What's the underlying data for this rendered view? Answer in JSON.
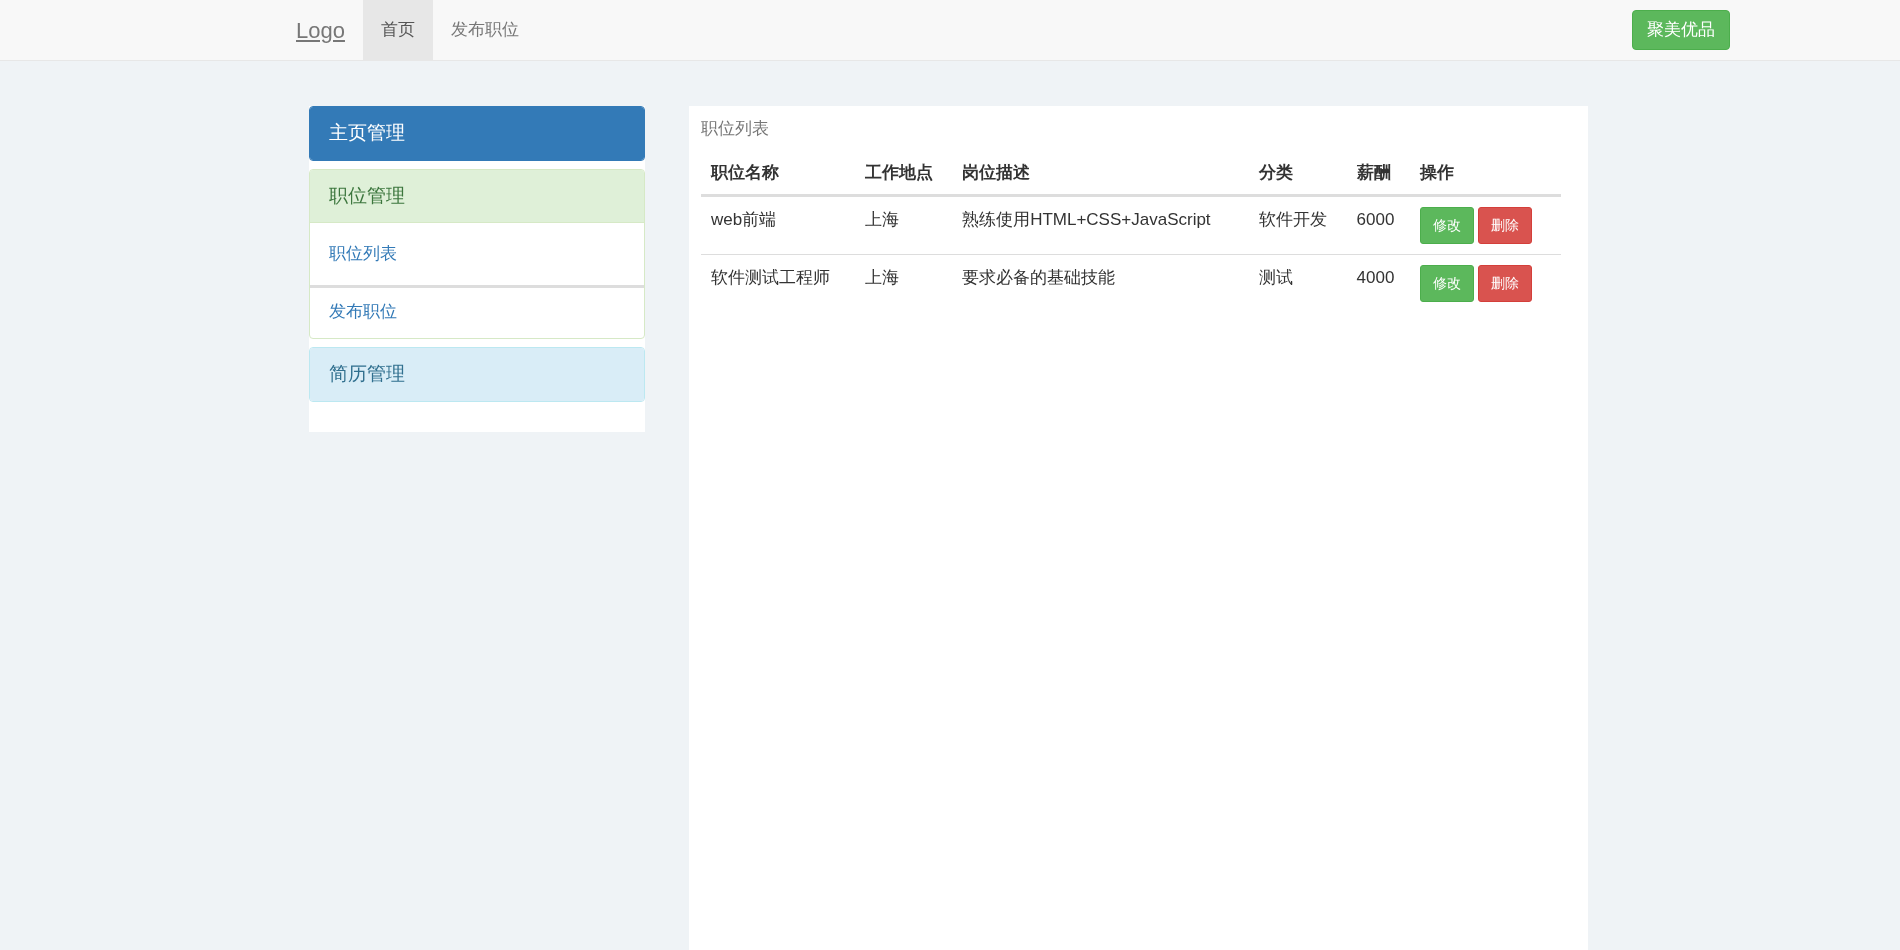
{
  "navbar": {
    "brand": "Logo",
    "tabs": [
      {
        "label": "首页",
        "selected": true
      },
      {
        "label": "发布职位",
        "selected": false
      }
    ],
    "button": "聚美优品"
  },
  "sidebar": {
    "panels": [
      {
        "kind": "primary",
        "title": "主页管理"
      },
      {
        "kind": "success",
        "title": "职位管理",
        "items": [
          "职位列表",
          "发布职位"
        ]
      },
      {
        "kind": "info",
        "title": "简历管理"
      }
    ]
  },
  "main": {
    "title": "职位列表",
    "table": {
      "columns": [
        "职位名称",
        "工作地点",
        "岗位描述",
        "分类",
        "薪酬",
        "操作"
      ],
      "rows": [
        {
          "cells": [
            "web前端",
            "上海",
            "熟练使用HTML+CSS+JavaScript",
            "软件开发",
            "6000"
          ],
          "actions": [
            {
              "kind": "edit",
              "label": "修改"
            },
            {
              "kind": "delete",
              "label": "删除"
            }
          ]
        },
        {
          "cells": [
            "软件测试工程师",
            "上海",
            "要求必备的基础技能",
            "测试",
            "4000"
          ],
          "actions": [
            {
              "kind": "edit",
              "label": "修改"
            },
            {
              "kind": "delete",
              "label": "删除"
            }
          ]
        }
      ]
    }
  }
}
